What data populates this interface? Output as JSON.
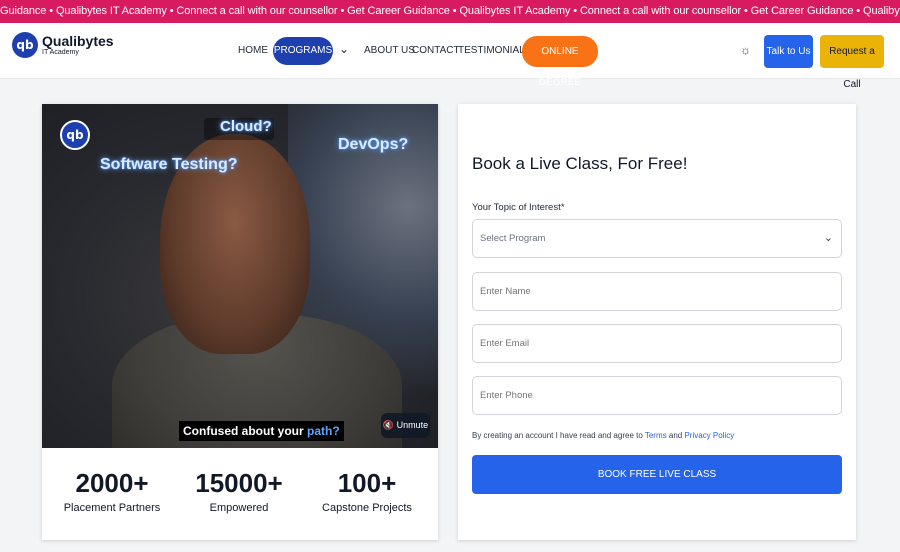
{
  "ticker": {
    "text": "Guidance • Qualibytes IT Academy • Connect a call with our counsellor • Get Career Guidance • Qualibytes IT Academy • Connect a call with our counsellor • Get Career Guidance • Qualibytes IT Academy • Connect a call with our counsellor • Get Career Guidance • Qualibyt"
  },
  "header": {
    "logo_mark": "qb",
    "logo_name": "Qualibytes",
    "logo_sub": "IT Academy",
    "nav": {
      "home": "HOME",
      "programs": "PROGRAMS",
      "chevron": "⌄",
      "about": "ABOUT US",
      "contact": "CONTACT",
      "testimonials": "TESTIMONIALS",
      "online_degree": "ONLINE DEGREE",
      "theme_icon": "☼",
      "talk": "Talk to Us",
      "request": "Request a Call"
    }
  },
  "video": {
    "logo_mark": "qb",
    "bubble_cloud": "Cloud?",
    "bubble_testing": "Software Testing?",
    "bubble_devops": "DevOps?",
    "caption_prefix": "Confused about your ",
    "caption_highlight": "path?",
    "unmute_icon": "🔇",
    "unmute_label": "Unmute"
  },
  "stats": [
    {
      "value": "2000+",
      "label": "Placement Partners"
    },
    {
      "value": "15000+",
      "label": "Empowered"
    },
    {
      "value": "100+",
      "label": "Capstone Projects"
    }
  ],
  "form": {
    "title": "Book a Live Class, For Free!",
    "topic_label": "Your Topic of Interest*",
    "select_placeholder": "Select Program",
    "name_placeholder": "Enter Name",
    "email_placeholder": "Enter Email",
    "phone_placeholder": "Enter Phone",
    "terms_prefix": "By creating an account I have read and agree to ",
    "terms_link": "Terms",
    "terms_and": " and ",
    "privacy_link": "Privacy Policy",
    "submit": "BOOK FREE LIVE CLASS"
  },
  "colors": {
    "ticker_bg": "#d81b60",
    "primary": "#2563eb",
    "programs_bg": "#1e40af",
    "online_degree_bg": "#f97316",
    "request_bg": "#eab308"
  }
}
